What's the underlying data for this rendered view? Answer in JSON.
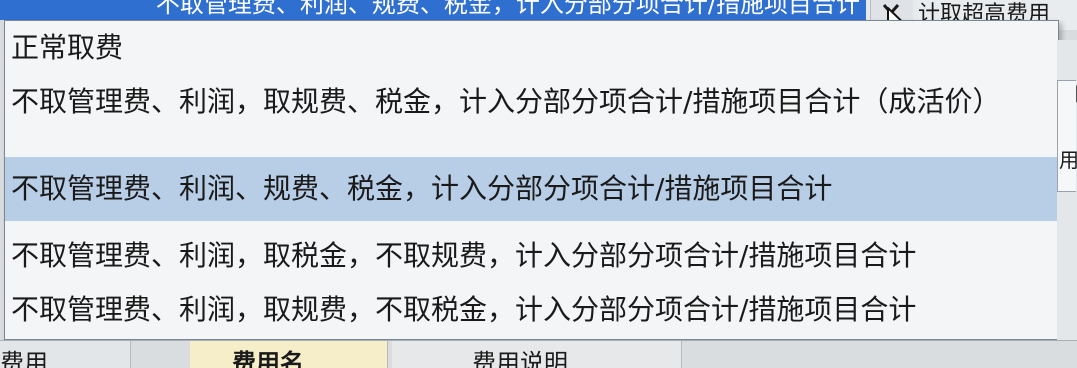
{
  "combo": {
    "selected_text": "不取管理费、利润、规费、税金，计入分部分项合计/措施项目合计"
  },
  "side_label": "计取超高费用",
  "dropdown": {
    "options": [
      "正常取费",
      "不取管理费、利润，取规费、税金，计入分部分项合计/措施项目合计（成活价）",
      "不取管理费、利润、规费、税金，计入分部分项合计/措施项目合计",
      "不取管理费、利润，取税金，不取规费，计入分部分项合计/措施项目合计",
      "不取管理费、利润，取规费，不取税金，计入分部分项合计/措施项目合计"
    ],
    "highlighted_index": 2
  },
  "right_edge": {
    "fragment_1": "用",
    "fragment_2": "用"
  },
  "bottom_tabs": [
    "费用",
    "费用名",
    "费用说明"
  ]
}
